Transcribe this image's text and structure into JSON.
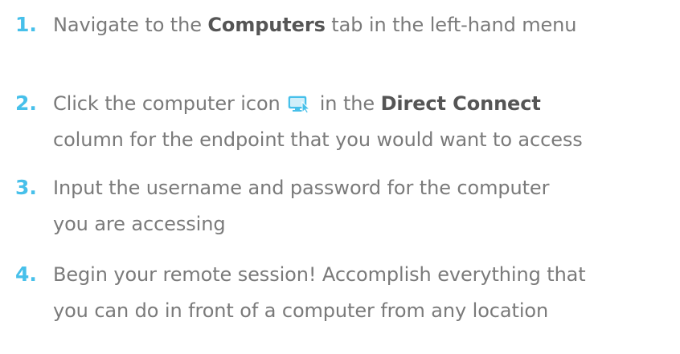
{
  "steps": [
    {
      "number": "1.",
      "before": "Navigate to the ",
      "bold": "Computers",
      "after": " tab in the left-hand menu"
    },
    {
      "number": "2.",
      "before": "Click the computer icon ",
      "icon": "computer-connect-icon",
      "middle": " in the ",
      "bold": "Direct Connect",
      "line2": "column for the endpoint that you would want to access"
    },
    {
      "number": "3.",
      "line1": "Input the username and password for the computer",
      "line2": "you are accessing"
    },
    {
      "number": "4.",
      "line1": "Begin your remote session! Accomplish everything that",
      "line2": "you can do in front of a computer from any location"
    }
  ],
  "colors": {
    "accent": "#47c0ea",
    "text": "#7a7a7a",
    "bold_text": "#555555"
  }
}
